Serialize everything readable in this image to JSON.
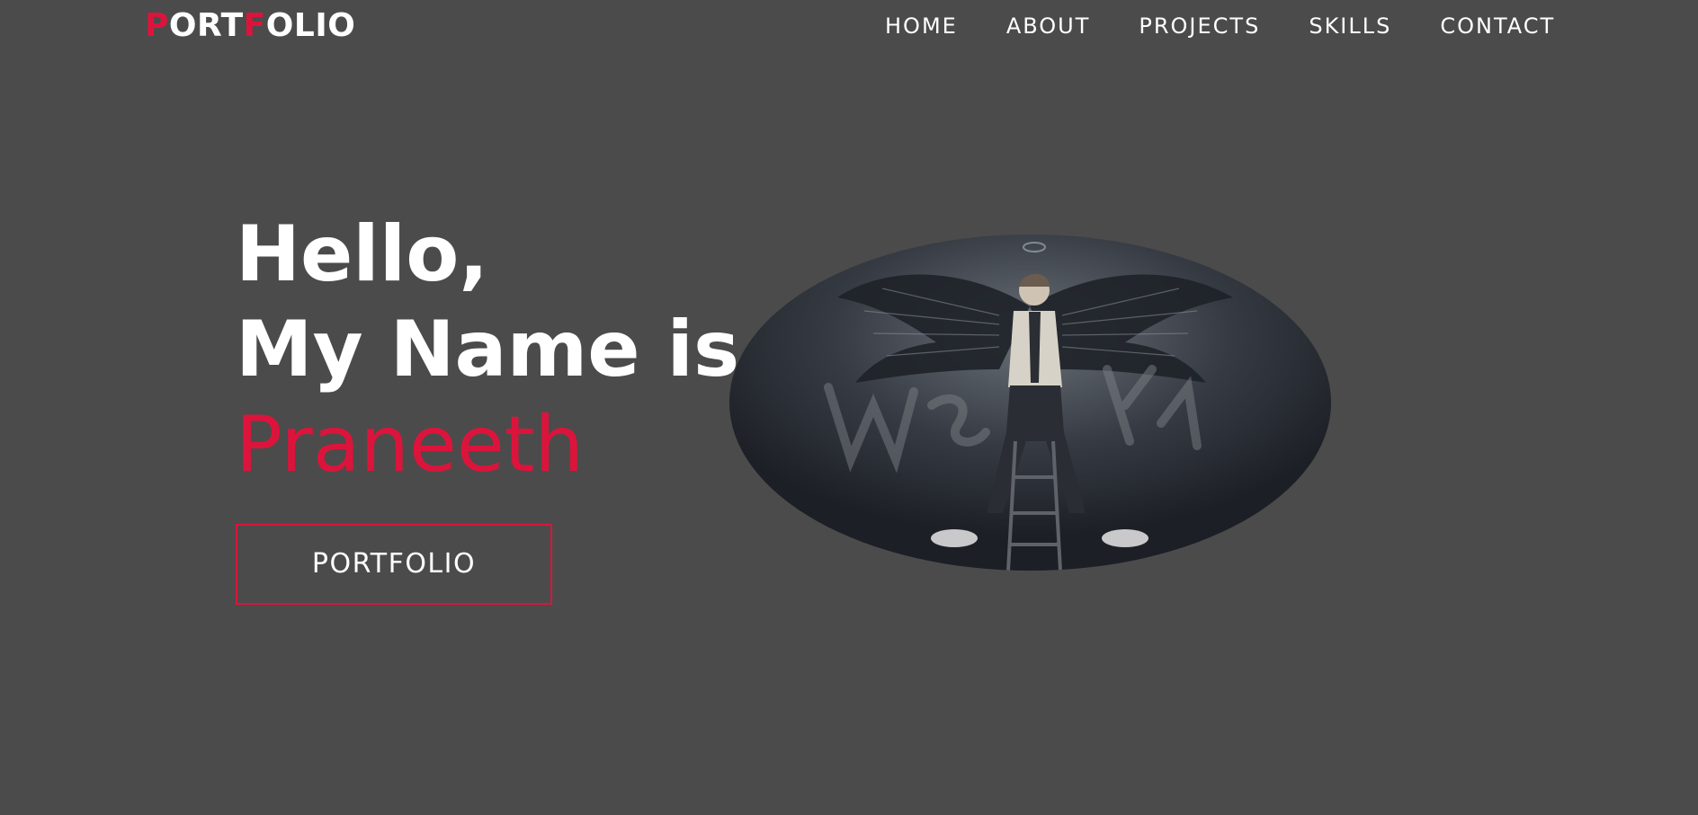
{
  "header": {
    "logo": {
      "letters": [
        {
          "ch": "P",
          "accent": true
        },
        {
          "ch": "O",
          "accent": false
        },
        {
          "ch": "R",
          "accent": false
        },
        {
          "ch": "T",
          "accent": false
        },
        {
          "ch": "F",
          "accent": true
        },
        {
          "ch": "O",
          "accent": false
        },
        {
          "ch": "L",
          "accent": false
        },
        {
          "ch": "I",
          "accent": false
        },
        {
          "ch": "O",
          "accent": false
        }
      ]
    },
    "nav": {
      "home": "HOME",
      "about": "ABOUT",
      "projects": "PROJECTS",
      "skills": "SKILLS",
      "contact": "CONTACT"
    }
  },
  "hero": {
    "greeting": "Hello,",
    "intro": "My Name is",
    "name": "Praneeth",
    "cta_label": "PORTFOLIO"
  },
  "colors": {
    "background": "#4b4b4b",
    "accent": "#dc143c",
    "text": "#ffffff"
  }
}
